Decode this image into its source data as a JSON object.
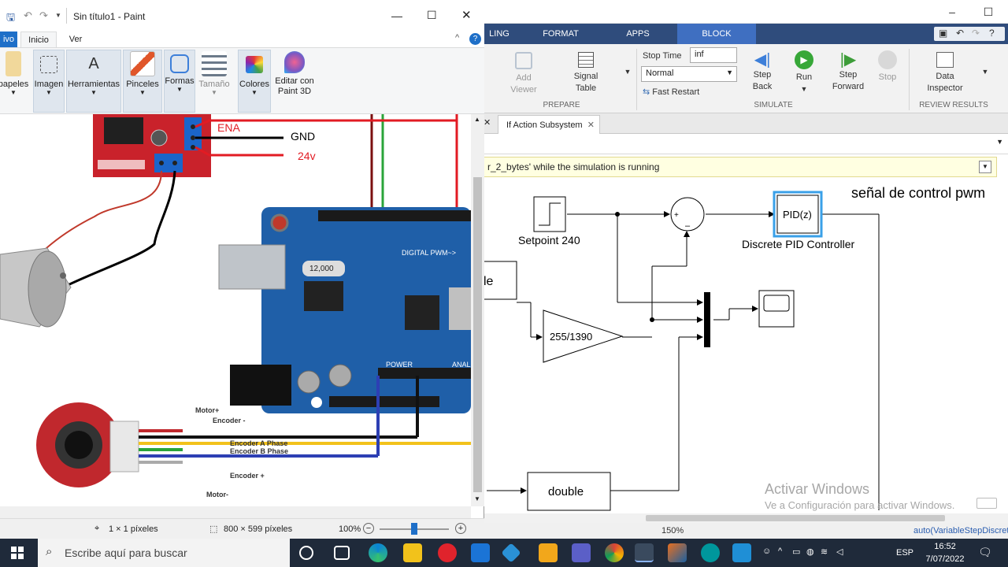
{
  "simulink": {
    "tabs": [
      "LING",
      "FORMAT",
      "APPS",
      "BLOCK"
    ],
    "active_tab": "BLOCK",
    "ribbon": {
      "add_viewer": "Add\nViewer",
      "signal_table": "Signal\nTable",
      "prepare": "PREPARE",
      "stop_time_label": "Stop Time",
      "stop_time_value": "inf",
      "mode_value": "Normal",
      "fast_restart": "Fast Restart",
      "step_back": "Step\nBack",
      "run": "Run",
      "step_forward": "Step\nForward",
      "stop": "Stop",
      "simulate": "SIMULATE",
      "data_inspector": "Data\nInspector",
      "review_results": "REVIEW RESULTS"
    },
    "doc_tab": "If Action Subsystem",
    "warning": "r_2_bytes' while the simulation is running",
    "diagram": {
      "title": "señal de control pwm",
      "setpoint_label": "Setpoint 240",
      "sum_plus": "+",
      "sum_minus": "–",
      "pid_text": "PID(z)",
      "pid_label": "Discrete PID Controller",
      "gain_text": "255/1390",
      "left_block_text": "le",
      "double_text": "double"
    },
    "watermark": {
      "line1": "Activar Windows",
      "line2": "Ve a Configuración para activar Windows."
    },
    "status": {
      "zoom": "150%",
      "solver": "auto(VariableStepDiscrete"
    }
  },
  "paint": {
    "title": "Sin título1 - Paint",
    "tabs": [
      "ivo",
      "Inicio",
      "Ver"
    ],
    "groups": [
      "papeles",
      "Imagen",
      "Herramientas",
      "Pinceles",
      "Formas",
      "Tamaño",
      "Colores",
      "Editar con\nPaint 3D"
    ],
    "canvas_labels": {
      "ena": "ENA",
      "gnd": "GND",
      "v24": "24v",
      "motor_plus": "Motor+",
      "encoder_minus": "Encoder -",
      "enc_a": "Encoder A Phase",
      "enc_b": "Encoder B Phase",
      "encoder_plus": "Encoder +",
      "motor_minus": "Motor-",
      "board_digital": "DIGITAL PWM~>",
      "board_power": "POWER",
      "board_analog": "ANAL",
      "crystal": "12,000"
    },
    "status": {
      "cursor": "1 × 1 píxeles",
      "size": "800 × 599 píxeles",
      "zoom": "100%"
    }
  },
  "taskbar": {
    "search_placeholder": "Escribe aquí para buscar",
    "lang": "ESP",
    "time": "16:52",
    "date": "7/07/2022"
  },
  "colors": {
    "simulink_tabbar": "#2f4c7c",
    "simulink_active_tab": "#3f6fc1",
    "taskbar": "#1f2a3a",
    "arduino_board": "#1f5fa8",
    "driver_board": "#c9222b"
  }
}
